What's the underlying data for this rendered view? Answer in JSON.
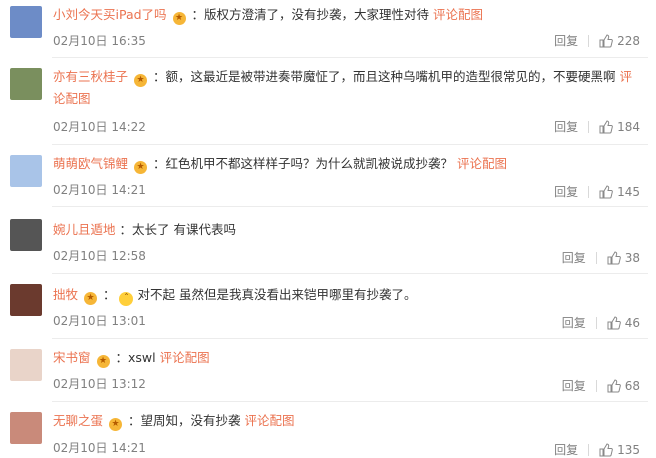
{
  "actions": {
    "reply_label": "回复"
  },
  "comments": [
    {
      "username": "小刘今天买iPad了吗",
      "colon": "：",
      "text": "版权方澄清了，没有抄袭，大家理性对待",
      "pic_link": "评论配图",
      "time": "02月10日 16:35",
      "likes": "228",
      "avatar_color": "#6d8cc7"
    },
    {
      "username": "亦有三秋桂子",
      "colon": "：",
      "text": "额，这最近是被带进奏带魔怔了，而且这种乌嘴机甲的造型很常见的，不要硬黑啊",
      "pic_link": "评论配图",
      "time": "02月10日 14:22",
      "likes": "184",
      "avatar_color": "#7a8f5e"
    },
    {
      "username": "萌萌欧气锦鲤",
      "colon": "：",
      "text": "红色机甲不都这样样子吗？为什么就凯被说成抄袭？",
      "pic_link": "评论配图",
      "time": "02月10日 14:21",
      "likes": "145",
      "avatar_color": "#a9c4e8"
    },
    {
      "username": "婉儿且遁地",
      "colon": "：",
      "text": "太长了 有课代表吗",
      "time": "02月10日 12:58",
      "likes": "38",
      "avatar_color": "#555555"
    },
    {
      "username": "拙牧",
      "colon": "：",
      "text": "对不起 虽然但是我真没看出来铠甲哪里有抄袭了。",
      "time": "02月10日 13:01",
      "likes": "46",
      "avatar_color": "#6b3a2e"
    },
    {
      "username": "宋书窗",
      "colon": "：",
      "text": "xswl",
      "pic_link": "评论配图",
      "time": "02月10日 13:12",
      "likes": "68",
      "avatar_color": "#e9d4c9"
    },
    {
      "username": "无聊之蛋",
      "colon": "：",
      "text": "望周知，没有抄袭",
      "pic_link": "评论配图",
      "time": "02月10日 14:21",
      "likes": "135",
      "avatar_color": "#c98a7a"
    }
  ]
}
